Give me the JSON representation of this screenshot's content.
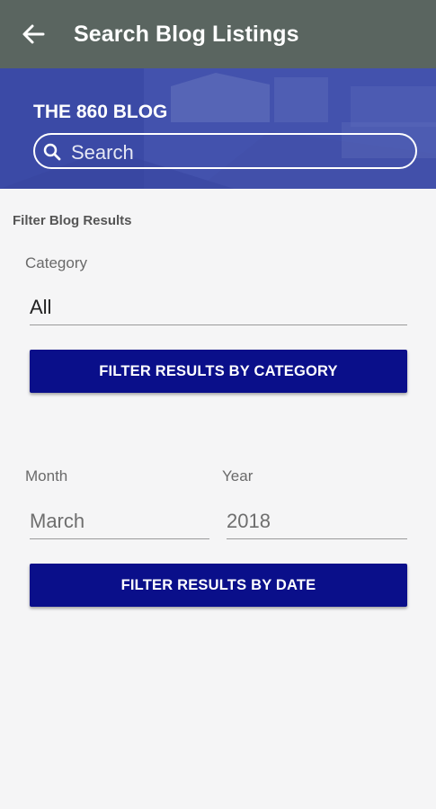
{
  "appbar": {
    "title": "Search Blog Listings"
  },
  "hero": {
    "title": "THE 860 BLOG",
    "search_placeholder": "Search"
  },
  "filter": {
    "section_title": "Filter Blog Results",
    "category": {
      "label": "Category",
      "value": "All"
    },
    "category_button": "FILTER RESULTS BY CATEGORY",
    "month": {
      "label": "Month",
      "value": "March"
    },
    "year": {
      "label": "Year",
      "value": "2018"
    },
    "date_button": "FILTER RESULTS BY DATE"
  },
  "colors": {
    "appbar": "#5a6560",
    "hero": "#3d4ca7",
    "button": "#0a0f8a",
    "background": "#f5f5f6"
  },
  "icons": {
    "back": "arrow-left-icon",
    "search": "magnifier-icon"
  }
}
